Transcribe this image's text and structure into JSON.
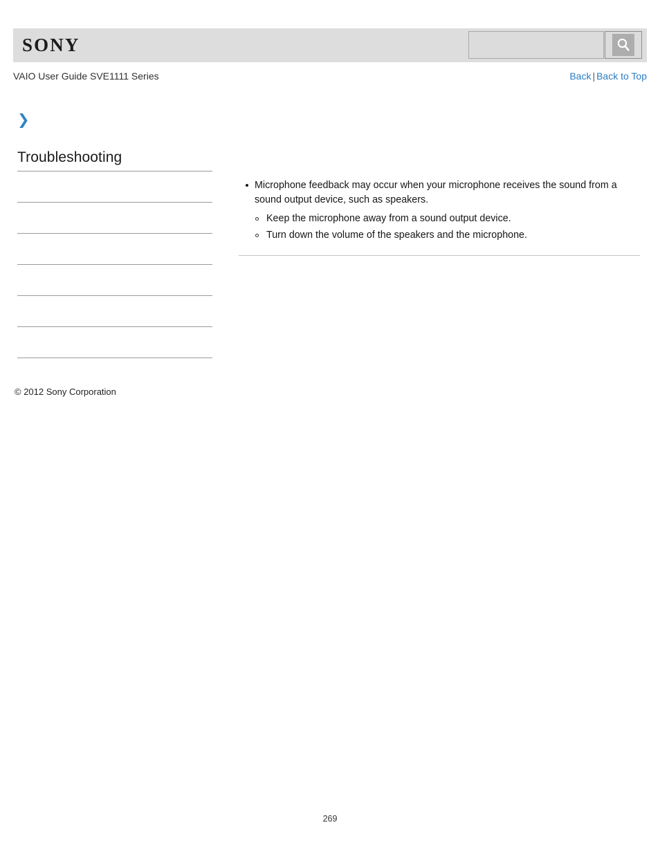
{
  "header": {
    "logo_text": "SONY",
    "search": {
      "value": "",
      "placeholder": "",
      "icon": "search-icon",
      "button_label": ""
    },
    "background_color": "#dddddd"
  },
  "subheader": {
    "guide_title": "VAIO User Guide SVE1111 Series",
    "nav": {
      "back_label": "Back",
      "separator": "|",
      "back_to_top_label": "Back to Top",
      "link_color": "#2b7cc4"
    }
  },
  "breadcrumb": {
    "chevron_icon": "❯",
    "chevron_color": "#2f83c2",
    "label": ""
  },
  "sidebar": {
    "title": "Troubleshooting",
    "items": [
      {
        "label": ""
      },
      {
        "label": ""
      },
      {
        "label": ""
      },
      {
        "label": ""
      },
      {
        "label": ""
      },
      {
        "label": ""
      }
    ]
  },
  "main": {
    "bullets": [
      {
        "text": "Microphone feedback may occur when your microphone receives the sound from a sound output device, such as speakers.",
        "subitems": [
          "Keep the microphone away from a sound output device.",
          "Turn down the volume of the speakers and the microphone."
        ]
      }
    ]
  },
  "footer": {
    "copyright": "© 2012 Sony Corporation",
    "page_number": "269"
  }
}
